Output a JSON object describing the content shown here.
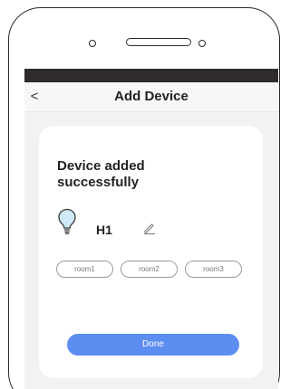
{
  "nav": {
    "back_icon": "chevron-left-icon",
    "title": "Add Device"
  },
  "card": {
    "message": "Device added successfully",
    "device": {
      "icon": "lightbulb-icon",
      "name": "H1",
      "edit_icon": "pencil-icon"
    },
    "rooms": [
      "room1",
      "room2",
      "room3"
    ],
    "done_label": "Done"
  },
  "colors": {
    "status_bar": "#2f2b2b",
    "screen_background": "#f2f2f2",
    "card_background": "#ffffff",
    "accent": "#5b8ef0",
    "bulb_fill": "#cfe9f7"
  }
}
